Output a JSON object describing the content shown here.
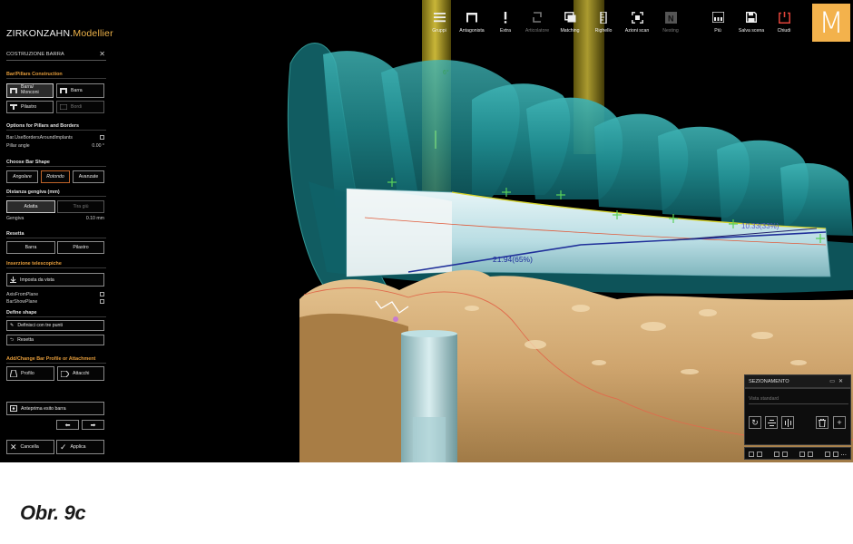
{
  "app": {
    "brand_main": "ZIRKONZAHN.",
    "brand_accent": "Modellier",
    "logo_letter": "M"
  },
  "toolbar": {
    "items": [
      {
        "label": "Gruppi",
        "icon": "menu-icon"
      },
      {
        "label": "Antagonista",
        "icon": "antagonist-icon"
      },
      {
        "label": "Extra",
        "icon": "exclamation-icon"
      },
      {
        "label": "Articolatore",
        "icon": "articulator-icon",
        "disabled": true
      },
      {
        "label": "Matching",
        "icon": "matching-icon"
      },
      {
        "label": "Righello",
        "icon": "ruler-icon"
      },
      {
        "label": "Azioni scan",
        "icon": "scan-actions-icon"
      },
      {
        "label": "Nesting",
        "icon": "nesting-icon",
        "disabled": true
      },
      {
        "label": "Più",
        "icon": "more-icon"
      },
      {
        "label": "Salva scena",
        "icon": "save-icon"
      },
      {
        "label": "Chiudi",
        "icon": "power-icon"
      }
    ]
  },
  "panel": {
    "title": "COSTRUZIONE BARRA",
    "bar_pillars_section": "Bar/Pillars Construction",
    "btn_barra_monconi": "Barra/ Monconi",
    "btn_barra": "Barra",
    "btn_pilastro": "Pilastro",
    "btn_bordi": "Bordi",
    "options_section": "Options for Pillars and Borders",
    "opt_use_borders": "Bar.UseBordersAroundImplants",
    "opt_pillar_angle": "Pillar angle",
    "opt_pillar_angle_value": "0.00 °",
    "shape_section": "Choose Bar Shape",
    "shape_angolare": "Angolare",
    "shape_rotondo": "Rotondo",
    "shape_avanzate": "Avanzate",
    "distance_section": "Distanza gengiva (mm)",
    "btn_adatta": "Adatta",
    "btn_tira_giu": "Tira giù",
    "gengiva_label": "Gengiva",
    "gengiva_value": "0.10 mm",
    "reset_section": "Resetta",
    "reset_barra": "Barra",
    "reset_pilastro": "Pilastro",
    "telescopic_section": "Inserzione telescopiche",
    "btn_imposta_vista": "Imposta da vista",
    "axis_from_plane": "AxisFromPlane",
    "bar_show_plane": "BarShowPlane",
    "define_shape_section": "Define shape",
    "btn_definisci": "Definisci con tre punti",
    "btn_resetta": "Resetta",
    "profile_section": "Add/Change Bar Profile or Attachment",
    "btn_profilo": "Profilo",
    "btn_attacchi": "Attacchi",
    "btn_anteprima": "Anteprima esito barra",
    "btn_cancella": "Cancella",
    "btn_applica": "Applica"
  },
  "viewport": {
    "angle_label": "6°",
    "measure_1": "21.94(65%)",
    "measure_2": "10.33(33%)"
  },
  "sectioning": {
    "title": "SEZIONAMENTO",
    "placeholder": "Vista standard",
    "more": "..."
  },
  "caption": "Obr. 9c",
  "colors": {
    "brand_accent": "#f0b44a",
    "logo_bg": "#f3b24c",
    "section_orange": "#e39b3a",
    "gum": "#d6b07c",
    "teeth": "#2a8f92",
    "bar": "#cde6ea"
  }
}
